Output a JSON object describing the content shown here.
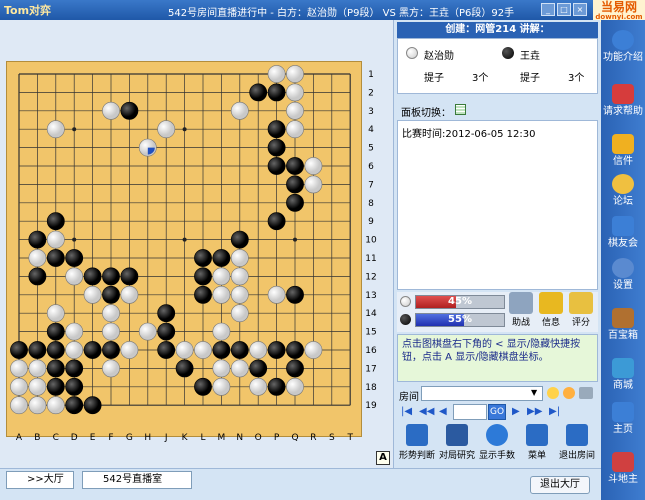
{
  "window": {
    "title": "542号房间直播进行中 - 白方：赵治勋（P9段） VS 黑方：王垚（P6段）92手",
    "logo": "Tom对弈",
    "brand": "当易网",
    "brand_sub": "downyi.com",
    "min": "_",
    "max": "□",
    "close": "×"
  },
  "info": {
    "header": "创建：网管214   讲解：",
    "white_name": "赵治勋",
    "black_name": "王垚",
    "captures_label": "提子",
    "white_captures": "3个",
    "black_captures": "3个"
  },
  "panel_switch": "面板切换：",
  "chat": {
    "match_time": "比赛时间:2012-06-05 12:30"
  },
  "eval": {
    "white_pct": 45,
    "black_pct": 55,
    "white_label": "45%",
    "black_label": "55%",
    "buttons": [
      "助战",
      "信息",
      "评分"
    ]
  },
  "tip": "点击图棋盘右下角的 < 显示/隐藏快捷按钮，点击 A 显示/隐藏棋盘坐标。",
  "room_label": "房间",
  "nav": {
    "first": "|◀",
    "prev10": "◀◀",
    "prev": "◀",
    "go": "GO",
    "next": "▶",
    "next10": "▶▶",
    "last": "▶|"
  },
  "tools": [
    "形势判断",
    "对局研究",
    "显示手数",
    "菜单",
    "退出房间"
  ],
  "sidebar": [
    "功能介绍",
    "请求帮助",
    "信件",
    "论坛",
    "棋友会",
    "设置",
    "百宝箱",
    "商城",
    "主页",
    "斗地主"
  ],
  "bottom": {
    "tab1": ">>大厅",
    "tab2": "542号直播室",
    "exit": "退出大厅",
    "a_button": "A"
  },
  "board": {
    "cols": [
      "A",
      "B",
      "C",
      "D",
      "E",
      "F",
      "G",
      "H",
      "J",
      "K",
      "L",
      "M",
      "N",
      "O",
      "P",
      "Q",
      "R",
      "S",
      "T"
    ],
    "rows": [
      "1",
      "2",
      "3",
      "4",
      "5",
      "6",
      "7",
      "8",
      "9",
      "10",
      "11",
      "12",
      "13",
      "14",
      "15",
      "16",
      "17",
      "18",
      "19"
    ],
    "black": [
      [
        7,
        3
      ],
      [
        14,
        2
      ],
      [
        15,
        2
      ],
      [
        15,
        4
      ],
      [
        15,
        5
      ],
      [
        15,
        6
      ],
      [
        16,
        7
      ],
      [
        16,
        8
      ],
      [
        15,
        9
      ],
      [
        3,
        9
      ],
      [
        2,
        10
      ],
      [
        3,
        11
      ],
      [
        4,
        11
      ],
      [
        6,
        12
      ],
      [
        2,
        12
      ],
      [
        5,
        12
      ],
      [
        6,
        13
      ],
      [
        12,
        11
      ],
      [
        11,
        12
      ],
      [
        11,
        11
      ],
      [
        13,
        10
      ],
      [
        11,
        13
      ],
      [
        16,
        13
      ],
      [
        9,
        14
      ],
      [
        9,
        15
      ],
      [
        9,
        16
      ],
      [
        3,
        15
      ],
      [
        1,
        16
      ],
      [
        2,
        16
      ],
      [
        3,
        16
      ],
      [
        5,
        16
      ],
      [
        6,
        16
      ],
      [
        3,
        17
      ],
      [
        4,
        17
      ],
      [
        4,
        18
      ],
      [
        3,
        18
      ],
      [
        4,
        19
      ],
      [
        5,
        19
      ],
      [
        12,
        16
      ],
      [
        13,
        16
      ],
      [
        15,
        16
      ],
      [
        16,
        16
      ],
      [
        10,
        17
      ],
      [
        11,
        18
      ],
      [
        14,
        17
      ],
      [
        15,
        18
      ],
      [
        16,
        17
      ],
      [
        7,
        12
      ],
      [
        16,
        6
      ]
    ],
    "white": [
      [
        6,
        3
      ],
      [
        3,
        4
      ],
      [
        9,
        4
      ],
      [
        13,
        3
      ],
      [
        15,
        1
      ],
      [
        16,
        1
      ],
      [
        16,
        2
      ],
      [
        16,
        3
      ],
      [
        16,
        4
      ],
      [
        17,
        6
      ],
      [
        17,
        7
      ],
      [
        16,
        6
      ],
      [
        2,
        11
      ],
      [
        3,
        10
      ],
      [
        4,
        12
      ],
      [
        5,
        12
      ],
      [
        5,
        13
      ],
      [
        6,
        14
      ],
      [
        7,
        13
      ],
      [
        7,
        12
      ],
      [
        12,
        12
      ],
      [
        13,
        11
      ],
      [
        12,
        13
      ],
      [
        13,
        12
      ],
      [
        13,
        13
      ],
      [
        13,
        14
      ],
      [
        15,
        13
      ],
      [
        12,
        15
      ],
      [
        8,
        15
      ],
      [
        6,
        15
      ],
      [
        4,
        15
      ],
      [
        2,
        17
      ],
      [
        1,
        17
      ],
      [
        1,
        18
      ],
      [
        2,
        19
      ],
      [
        1,
        19
      ],
      [
        3,
        19
      ],
      [
        2,
        18
      ],
      [
        4,
        16
      ],
      [
        4,
        17
      ],
      [
        6,
        17
      ],
      [
        7,
        16
      ],
      [
        12,
        17
      ],
      [
        13,
        17
      ],
      [
        12,
        18
      ],
      [
        14,
        18
      ],
      [
        16,
        18
      ],
      [
        17,
        16
      ],
      [
        10,
        16
      ],
      [
        11,
        16
      ],
      [
        14,
        16
      ],
      [
        3,
        14
      ]
    ],
    "last": [
      8,
      5
    ]
  }
}
